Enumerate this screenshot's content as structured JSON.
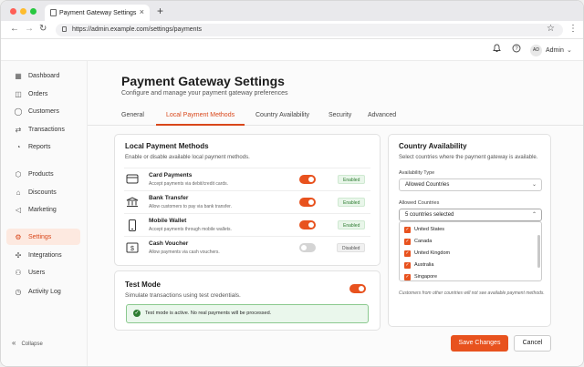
{
  "browser": {
    "tab_title": "Payment Gateway Settings",
    "url": "https://admin.example.com/settings/payments"
  },
  "header": {
    "avatar_initials": "AD",
    "user_name": "Admin"
  },
  "sidebar": {
    "items": [
      {
        "label": "Dashboard",
        "icon": "grid-icon"
      },
      {
        "label": "Orders",
        "icon": "bag-icon"
      },
      {
        "label": "Customers",
        "icon": "user-icon"
      },
      {
        "label": "Transactions",
        "icon": "transfer-icon"
      },
      {
        "label": "Reports",
        "icon": "chart-icon"
      },
      {
        "label": "Products",
        "icon": "box-icon"
      },
      {
        "label": "Discounts",
        "icon": "tag-icon"
      },
      {
        "label": "Marketing",
        "icon": "megaphone-icon"
      },
      {
        "label": "Settings",
        "icon": "gear-icon",
        "active": true
      },
      {
        "label": "Integrations",
        "icon": "integration-icon"
      },
      {
        "label": "Users",
        "icon": "users-icon"
      },
      {
        "label": "Activity Log",
        "icon": "clock-icon"
      }
    ],
    "collapse_label": "Collapse"
  },
  "page": {
    "title": "Payment Gateway Settings",
    "subtitle": "Configure and manage your payment gateway preferences",
    "tabs": [
      "General",
      "Local Payment Methods",
      "Country Availability",
      "Security",
      "Advanced"
    ],
    "active_tab": "Local Payment Methods"
  },
  "local_methods": {
    "title": "Local Payment Methods",
    "subtitle": "Enable or disable available local payment methods.",
    "methods": [
      {
        "name": "Card Payments",
        "desc": "Accept payments via debit/credit cards.",
        "enabled": true,
        "status": "Enabled",
        "icon": "card-icon"
      },
      {
        "name": "Bank Transfer",
        "desc": "Allow customers to pay via bank transfer.",
        "enabled": true,
        "status": "Enabled",
        "icon": "bank-icon"
      },
      {
        "name": "Mobile Wallet",
        "desc": "Accept payments through mobile wallets.",
        "enabled": true,
        "status": "Enabled",
        "icon": "phone-icon"
      },
      {
        "name": "Cash Voucher",
        "desc": "Allow payments via cash vouchers.",
        "enabled": false,
        "status": "Disabled",
        "icon": "voucher-icon"
      }
    ]
  },
  "test_mode": {
    "title": "Test Mode",
    "subtitle": "Simulate transactions using test credentials.",
    "enabled": true,
    "alert": "Test mode is active. No real payments will be processed."
  },
  "country": {
    "title": "Country Availability",
    "subtitle": "Select countries where the payment gateway is available.",
    "type_label": "Availability Type",
    "type_value": "Allowed Countries",
    "allowed_label": "Allowed Countries",
    "allowed_summary": "5 countries selected",
    "countries": [
      "United States",
      "Canada",
      "United Kingdom",
      "Australia",
      "Singapore"
    ],
    "note": "Customers from other countries will not see available payment methods."
  },
  "actions": {
    "save": "Save Changes",
    "cancel": "Cancel"
  },
  "colors": {
    "accent": "#e8521e",
    "toggle_off": "#d4d4d4",
    "enabled_green": "#2e7d32"
  }
}
